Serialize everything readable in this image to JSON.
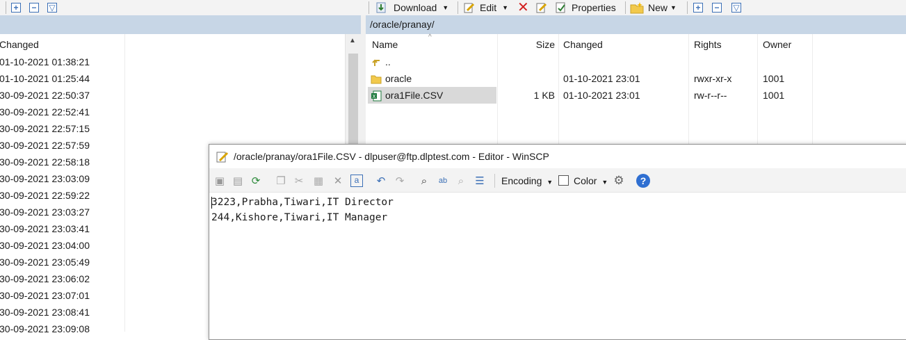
{
  "toolbar": {
    "download_label": "Download",
    "edit_label": "Edit",
    "properties_label": "Properties",
    "new_label": "New"
  },
  "left_panel": {
    "column_changed": "Changed",
    "rows": [
      "01-10-2021  01:38:21",
      "01-10-2021  01:25:44",
      "30-09-2021  22:50:37",
      "30-09-2021  22:52:41",
      "30-09-2021  22:57:15",
      "30-09-2021  22:57:59",
      "30-09-2021  22:58:18",
      "30-09-2021  23:03:09",
      "30-09-2021  22:59:22",
      "30-09-2021  23:03:27",
      "30-09-2021  23:03:41",
      "30-09-2021  23:04:00",
      "30-09-2021  23:05:49",
      "30-09-2021  23:06:02",
      "30-09-2021  23:07:01",
      "30-09-2021  23:08:41",
      "30-09-2021  23:09:08"
    ]
  },
  "right_panel": {
    "path": "/oracle/pranay/",
    "columns": {
      "name": "Name",
      "size": "Size",
      "changed": "Changed",
      "rights": "Rights",
      "owner": "Owner"
    },
    "files": [
      {
        "name": "..",
        "size": "",
        "changed": "",
        "rights": "",
        "owner": "",
        "icon": "parent-dir-icon"
      },
      {
        "name": "oracle",
        "size": "",
        "changed": "01-10-2021 23:01",
        "rights": "rwxr-xr-x",
        "owner": "1001",
        "icon": "folder-icon"
      },
      {
        "name": "ora1File.CSV",
        "size": "1 KB",
        "changed": "01-10-2021 23:01",
        "rights": "rw-r--r--",
        "owner": "1001",
        "icon": "csv-file-icon"
      }
    ]
  },
  "editor": {
    "title": "/oracle/pranay/ora1File.CSV - dlpuser@ftp.dlptest.com - Editor - WinSCP",
    "encoding_label": "Encoding",
    "color_label": "Color",
    "lines": [
      "3223,Prabha,Tiwari,IT Director",
      "244,Kishore,Tiwari,IT Manager"
    ]
  },
  "colors": {
    "pathbar": "#c7d6e6",
    "selected_row": "#d9d9d9",
    "accent": "#3b6fb6"
  }
}
